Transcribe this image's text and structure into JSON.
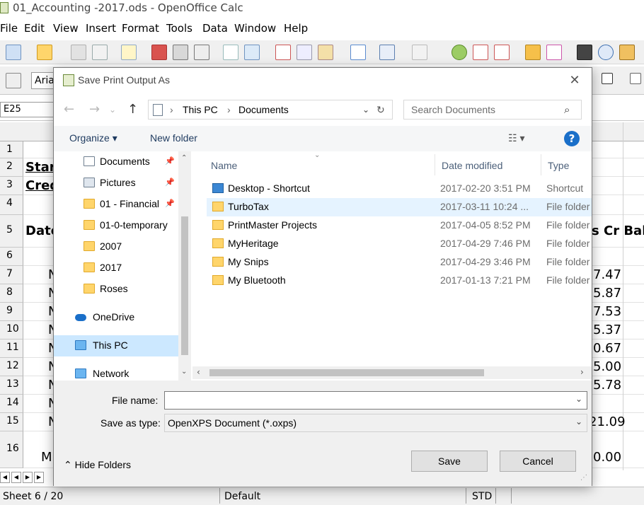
{
  "window": {
    "title": "01_Accounting -2017.ods - OpenOffice Calc"
  },
  "menu": [
    "File",
    "Edit",
    "View",
    "Insert",
    "Format",
    "Tools",
    "Data",
    "Window",
    "Help"
  ],
  "toolbar": {
    "font_name": "Aria"
  },
  "name_box": "E25",
  "sheet": {
    "rows": [
      "1",
      "2",
      "3",
      "4",
      "5",
      "6",
      "7",
      "8",
      "9",
      "10",
      "11",
      "12",
      "13",
      "14",
      "15",
      "16"
    ],
    "left_cells": [
      {
        "row": 2,
        "text": "Star"
      },
      {
        "row": 3,
        "text": "Cred"
      },
      {
        "row": 5,
        "text": "Date"
      },
      {
        "row": 7,
        "text": "N"
      },
      {
        "row": 8,
        "text": "N"
      },
      {
        "row": 9,
        "text": "N"
      },
      {
        "row": 10,
        "text": "N"
      },
      {
        "row": 11,
        "text": "N"
      },
      {
        "row": 12,
        "text": "N"
      },
      {
        "row": 13,
        "text": "N"
      },
      {
        "row": 14,
        "text": "N"
      },
      {
        "row": 15,
        "text": "N"
      },
      {
        "row": 16,
        "text": "M"
      }
    ],
    "right_header": "s Cr  Bal",
    "right_cells": [
      {
        "row": 7,
        "text": "7.47"
      },
      {
        "row": 8,
        "text": "5.87"
      },
      {
        "row": 9,
        "text": "7.53"
      },
      {
        "row": 10,
        "text": "5.37"
      },
      {
        "row": 11,
        "text": "0.67"
      },
      {
        "row": 12,
        "text": "5.00"
      },
      {
        "row": 13,
        "text": "5.78"
      },
      {
        "row": 15,
        "text": "21.09"
      },
      {
        "row": 16,
        "text": "0.00"
      }
    ]
  },
  "status": {
    "sheet": "Sheet 6 / 20",
    "style": "Default",
    "mode": "STD"
  },
  "dialog": {
    "title": "Save Print Output As",
    "breadcrumb": [
      "This PC",
      "Documents"
    ],
    "search_placeholder": "Search Documents",
    "commands": {
      "organize": "Organize",
      "new_folder": "New folder",
      "help": "?"
    },
    "nav": [
      {
        "label": "Documents",
        "kind": "doc",
        "pinned": true
      },
      {
        "label": "Pictures",
        "kind": "pic",
        "pinned": true
      },
      {
        "label": "01 - Financial",
        "kind": "folder",
        "pinned": true
      },
      {
        "label": "01-0-temporary",
        "kind": "folder",
        "pinned": false
      },
      {
        "label": "2007",
        "kind": "folder",
        "pinned": false
      },
      {
        "label": "2017",
        "kind": "folder",
        "pinned": false
      },
      {
        "label": "Roses",
        "kind": "folder",
        "pinned": false
      },
      {
        "label": "OneDrive",
        "kind": "cloud",
        "pinned": false
      },
      {
        "label": "This PC",
        "kind": "pc",
        "pinned": false
      },
      {
        "label": "Network",
        "kind": "net",
        "pinned": false
      }
    ],
    "columns": {
      "name": "Name",
      "date": "Date modified",
      "type": "Type"
    },
    "files": [
      {
        "name": "Desktop - Shortcut",
        "date": "2017-02-20 3:51 PM",
        "type": "Shortcut",
        "kind": "shortcut"
      },
      {
        "name": "TurboTax",
        "date": "2017-03-11 10:24 ...",
        "type": "File folder",
        "kind": "folder",
        "selected": true
      },
      {
        "name": "PrintMaster Projects",
        "date": "2017-04-05 8:52 PM",
        "type": "File folder",
        "kind": "folder"
      },
      {
        "name": "MyHeritage",
        "date": "2017-04-29 7:46 PM",
        "type": "File folder",
        "kind": "folder"
      },
      {
        "name": "My Snips",
        "date": "2017-04-29 3:46 PM",
        "type": "File folder",
        "kind": "folder"
      },
      {
        "name": "My Bluetooth",
        "date": "2017-01-13 7:21 PM",
        "type": "File folder",
        "kind": "folder"
      }
    ],
    "file_name_label": "File name:",
    "file_name_value": "",
    "save_type_label": "Save as type:",
    "save_type_value": "OpenXPS Document (*.oxps)",
    "hide_folders": "Hide Folders",
    "save": "Save",
    "cancel": "Cancel"
  }
}
